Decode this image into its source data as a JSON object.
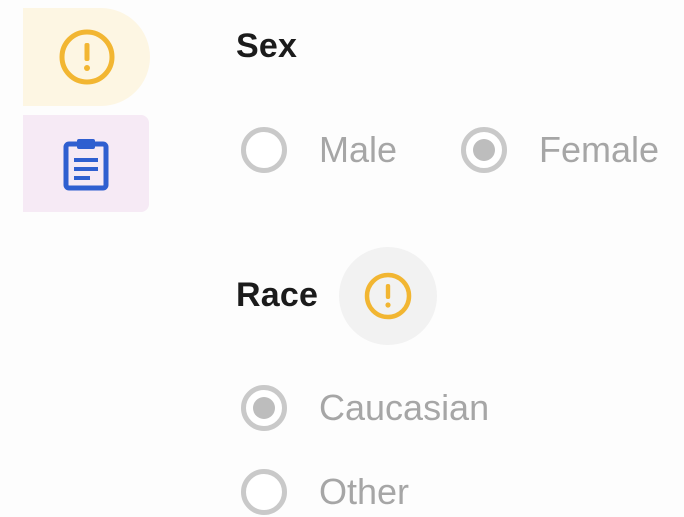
{
  "colors": {
    "warning": "#f2b632",
    "clipboard": "#2f5fd0",
    "warning_tab_bg": "#fdf6e3",
    "clipboard_tab_bg": "#f6eaf5",
    "radio_gray": "#bdbdbd",
    "title_text": "#1b1b1b",
    "option_text": "#a6a6a6"
  },
  "sidebar": {
    "tabs": [
      {
        "icon": "warning-circle-icon",
        "state": "warning"
      },
      {
        "icon": "clipboard-icon",
        "state": "default"
      }
    ]
  },
  "form": {
    "sex": {
      "label": "Sex",
      "options": [
        {
          "label": "Male",
          "selected": false
        },
        {
          "label": "Female",
          "selected": true
        }
      ]
    },
    "race": {
      "label": "Race",
      "alert_icon": "warning-circle-icon",
      "options": [
        {
          "label": "Caucasian",
          "selected": true
        },
        {
          "label": "Other",
          "selected": false
        }
      ]
    }
  }
}
